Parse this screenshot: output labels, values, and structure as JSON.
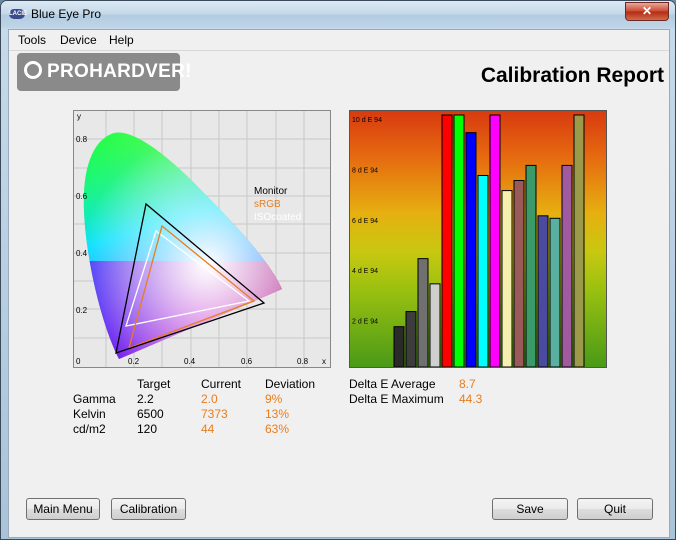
{
  "window": {
    "title": "Blue Eye Pro",
    "icon_text": "LACIE",
    "close_glyph": "✕"
  },
  "menu": {
    "items": [
      "Tools",
      "Device",
      "Help"
    ]
  },
  "logo": {
    "text": "PROHARDVER!"
  },
  "report": {
    "title": "Calibration Report"
  },
  "cie_chart": {
    "axis_x_label": "x",
    "axis_y_label": "y",
    "x_ticks": [
      "0",
      "0.2",
      "0.4",
      "0.6",
      "0.8"
    ],
    "y_ticks": [
      "0.2",
      "0.4",
      "0.6",
      "0.8"
    ],
    "legend": [
      {
        "label": "Monitor",
        "color": "#000000"
      },
      {
        "label": "sRGB",
        "color": "#e87d1e"
      },
      {
        "label": "ISOcoated",
        "color": "#ffffff"
      }
    ]
  },
  "chart_data": {
    "type": "bar",
    "y_tick_labels": [
      "10 d E 94",
      "8 d E 94",
      "6 d E 94",
      "4 d E 94",
      "2 d E 94"
    ],
    "ylim": [
      0,
      10
    ],
    "bars": [
      {
        "value": 1.6,
        "color": "#2a2a2a"
      },
      {
        "value": 2.2,
        "color": "#3d3d3d"
      },
      {
        "value": 4.3,
        "color": "#707070"
      },
      {
        "value": 3.3,
        "color": "#cfcfcf"
      },
      {
        "value": 10,
        "color": "#ff0000"
      },
      {
        "value": 10,
        "color": "#00ff00"
      },
      {
        "value": 9.3,
        "color": "#0000ff"
      },
      {
        "value": 7.6,
        "color": "#00ffff"
      },
      {
        "value": 10,
        "color": "#ff00ff"
      },
      {
        "value": 7.0,
        "color": "#f5f0b0"
      },
      {
        "value": 7.4,
        "color": "#9a5a5a"
      },
      {
        "value": 8.0,
        "color": "#3a9a6a"
      },
      {
        "value": 6.0,
        "color": "#4a4aa0"
      },
      {
        "value": 5.9,
        "color": "#5ab0a0"
      },
      {
        "value": 8.0,
        "color": "#a05aa0"
      },
      {
        "value": 10,
        "color": "#9a9a4a"
      }
    ]
  },
  "stats": {
    "headers": [
      "Target",
      "Current",
      "Deviation"
    ],
    "rows": [
      {
        "label": "Gamma",
        "target": "2.2",
        "current": "2.0",
        "deviation": "9%"
      },
      {
        "label": "Kelvin",
        "target": "6500",
        "current": "7373",
        "deviation": "13%"
      },
      {
        "label": "cd/m2",
        "target": "120",
        "current": "44",
        "deviation": "63%"
      }
    ],
    "delta_avg_label": "Delta E Average",
    "delta_avg_value": "8.7",
    "delta_max_label": "Delta E Maximum",
    "delta_max_value": "44.3"
  },
  "buttons": {
    "main_menu": "Main Menu",
    "calibration": "Calibration",
    "save": "Save",
    "quit": "Quit"
  }
}
